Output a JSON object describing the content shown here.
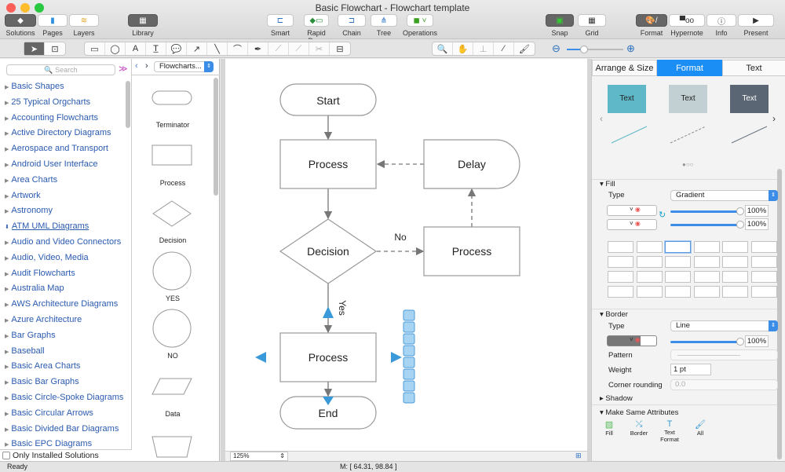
{
  "window": {
    "title": "Basic Flowchart - Flowchart template"
  },
  "toolbar": {
    "left": [
      "Solutions",
      "Pages",
      "Layers"
    ],
    "library": "Library",
    "center": [
      "Smart",
      "Rapid Draw",
      "Chain",
      "Tree",
      "Operations"
    ],
    "snap": "Snap",
    "grid": "Grid",
    "right": [
      "Format",
      "Hypernote",
      "Info",
      "Present"
    ]
  },
  "sidebar": {
    "search_placeholder": "Search",
    "items": [
      "Basic Shapes",
      "25 Typical Orgcharts",
      "Accounting Flowcharts",
      "Active Directory Diagrams",
      "Aerospace and Transport",
      "Android User Interface",
      "Area Charts",
      "Artwork",
      "Astronomy",
      "ATM UML Diagrams",
      "Audio and Video Connectors",
      "Audio, Video, Media",
      "Audit Flowcharts",
      "Australia Map",
      "AWS Architecture Diagrams",
      "Azure Architecture",
      "Bar Graphs",
      "Baseball",
      "Basic Area Charts",
      "Basic Bar Graphs",
      "Basic Circle-Spoke Diagrams",
      "Basic Circular Arrows",
      "Basic Divided Bar Diagrams",
      "Basic EPC Diagrams"
    ],
    "only_installed": "Only Installed Solutions"
  },
  "library": {
    "selector": "Flowcharts...",
    "shapes": [
      "Terminator",
      "Process",
      "Decision",
      "YES",
      "NO",
      "Data"
    ]
  },
  "diagram": {
    "start": "Start",
    "process1": "Process",
    "delay": "Delay",
    "decision": "Decision",
    "process2": "Process",
    "process3": "Process",
    "end": "End",
    "no": "No",
    "yes": "Yes"
  },
  "canvas": {
    "zoom": "125%"
  },
  "panel": {
    "tabs": [
      "Arrange & Size",
      "Format",
      "Text"
    ],
    "active_tab": "Format",
    "style_text": "Text",
    "fill": {
      "title": "Fill",
      "type_label": "Type",
      "type": "Gradient",
      "opacity1": "100%",
      "opacity2": "100%"
    },
    "border": {
      "title": "Border",
      "type_label": "Type",
      "type": "Line",
      "opacity": "100%",
      "pattern_label": "Pattern",
      "weight_label": "Weight",
      "weight": "1 pt",
      "corner_label": "Corner rounding",
      "corner": "0.0"
    },
    "shadow": "Shadow",
    "same": {
      "title": "Make Same Attributes",
      "buttons": [
        "Fill",
        "Border",
        "Text Format",
        "All"
      ]
    }
  },
  "status": {
    "text": "Ready",
    "coords": "M: [ 64.31, 98.84 ]"
  },
  "colors": {
    "accent": "#1a8ef5",
    "style1": "#5fb8c8",
    "style2": "#c2d0d4",
    "style3": "#5a6673",
    "handle": "#3a9ad9"
  }
}
